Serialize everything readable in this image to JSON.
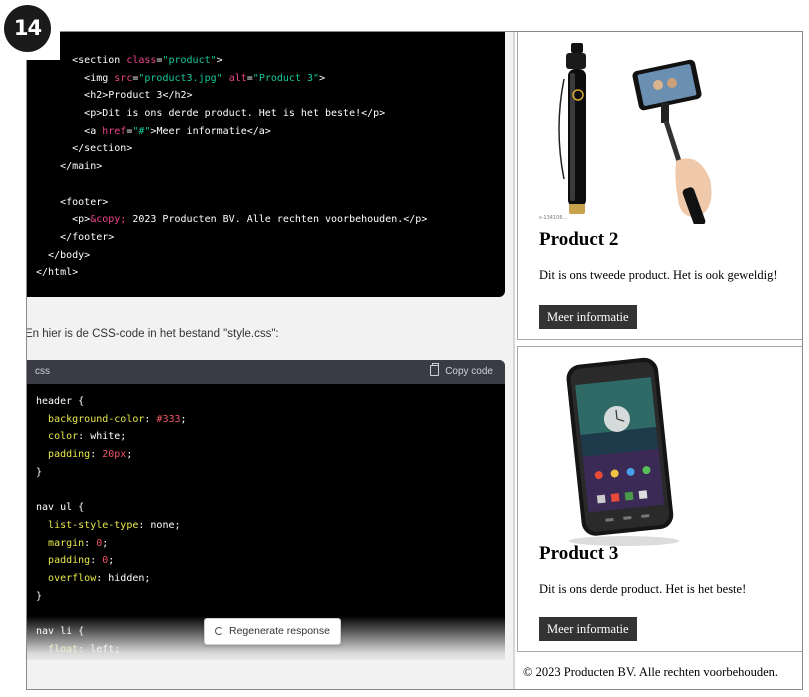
{
  "badge": {
    "number": "14"
  },
  "code_top_lines": [
    {
      "indent": "      ",
      "parts": [
        [
          "tag",
          "<section "
        ],
        [
          "attr",
          "class"
        ],
        [
          "tag",
          "="
        ],
        [
          "str",
          "\"product\""
        ],
        [
          "tag",
          ">"
        ]
      ]
    },
    {
      "indent": "        ",
      "parts": [
        [
          "tag",
          "<img "
        ],
        [
          "attr",
          "src"
        ],
        [
          "tag",
          "="
        ],
        [
          "str",
          "\"product3.jpg\""
        ],
        [
          "tag",
          " "
        ],
        [
          "attr",
          "alt"
        ],
        [
          "tag",
          "="
        ],
        [
          "str",
          "\"Product 3\""
        ],
        [
          "tag",
          ">"
        ]
      ]
    },
    {
      "indent": "        ",
      "parts": [
        [
          "tag",
          "<h2>Product 3</h2>"
        ]
      ]
    },
    {
      "indent": "        ",
      "parts": [
        [
          "tag",
          "<p>Dit is ons derde product. Het is het beste!</p>"
        ]
      ]
    },
    {
      "indent": "        ",
      "parts": [
        [
          "tag",
          "<a "
        ],
        [
          "attr",
          "href"
        ],
        [
          "tag",
          "="
        ],
        [
          "str",
          "\"#\""
        ],
        [
          "tag",
          ">Meer informatie</a>"
        ]
      ]
    },
    {
      "indent": "      ",
      "parts": [
        [
          "tag",
          "</section>"
        ]
      ]
    },
    {
      "indent": "    ",
      "parts": [
        [
          "tag",
          "</main>"
        ]
      ]
    },
    {
      "indent": "",
      "parts": [
        [
          "tag",
          ""
        ]
      ]
    },
    {
      "indent": "    ",
      "parts": [
        [
          "tag",
          "<footer>"
        ]
      ]
    },
    {
      "indent": "      ",
      "parts": [
        [
          "tag",
          "<p>"
        ],
        [
          "attr",
          "&copy;"
        ],
        [
          "tag",
          " 2023 Producten BV. Alle rechten voorbehouden.</p>"
        ]
      ]
    },
    {
      "indent": "    ",
      "parts": [
        [
          "tag",
          "</footer>"
        ]
      ]
    },
    {
      "indent": "  ",
      "parts": [
        [
          "tag",
          "</body>"
        ]
      ]
    },
    {
      "indent": "",
      "parts": [
        [
          "tag",
          "</html>"
        ]
      ]
    }
  ],
  "chat": {
    "intro_text": "En hier is de CSS-code in het bestand \"style.css\":",
    "code_lang": "css",
    "copy_label": "Copy code",
    "regenerate_label": "Regenerate response"
  },
  "css_lines": [
    {
      "indent": "",
      "parts": [
        [
          "tag",
          "header {"
        ]
      ]
    },
    {
      "indent": "  ",
      "parts": [
        [
          "kw",
          "background-color"
        ],
        [
          "tag",
          ": "
        ],
        [
          "num",
          "#333"
        ],
        [
          "tag",
          ";"
        ]
      ]
    },
    {
      "indent": "  ",
      "parts": [
        [
          "kw",
          "color"
        ],
        [
          "tag",
          ": white;"
        ]
      ]
    },
    {
      "indent": "  ",
      "parts": [
        [
          "kw",
          "padding"
        ],
        [
          "tag",
          ": "
        ],
        [
          "num",
          "20px"
        ],
        [
          "tag",
          ";"
        ]
      ]
    },
    {
      "indent": "",
      "parts": [
        [
          "tag",
          "}"
        ]
      ]
    },
    {
      "indent": "",
      "parts": [
        [
          "tag",
          ""
        ]
      ]
    },
    {
      "indent": "",
      "parts": [
        [
          "tag",
          "nav ul {"
        ]
      ]
    },
    {
      "indent": "  ",
      "parts": [
        [
          "kw",
          "list-style-type"
        ],
        [
          "tag",
          ": none;"
        ]
      ]
    },
    {
      "indent": "  ",
      "parts": [
        [
          "kw",
          "margin"
        ],
        [
          "tag",
          ": "
        ],
        [
          "num",
          "0"
        ],
        [
          "tag",
          ";"
        ]
      ]
    },
    {
      "indent": "  ",
      "parts": [
        [
          "kw",
          "padding"
        ],
        [
          "tag",
          ": "
        ],
        [
          "num",
          "0"
        ],
        [
          "tag",
          ";"
        ]
      ]
    },
    {
      "indent": "  ",
      "parts": [
        [
          "kw",
          "overflow"
        ],
        [
          "tag",
          ": hidden;"
        ]
      ]
    },
    {
      "indent": "",
      "parts": [
        [
          "tag",
          "}"
        ]
      ]
    },
    {
      "indent": "",
      "parts": [
        [
          "tag",
          ""
        ]
      ]
    },
    {
      "indent": "",
      "parts": [
        [
          "tag",
          "nav li {"
        ]
      ]
    },
    {
      "indent": "  ",
      "parts": [
        [
          "kw",
          "float"
        ],
        [
          "tag",
          ": left;"
        ]
      ]
    }
  ],
  "preview": {
    "product2": {
      "image_caption": "s-134106...",
      "title": "Product 2",
      "text": "Dit is ons tweede product. Het is ook geweldig!",
      "button": "Meer informatie"
    },
    "product3": {
      "title": "Product 3",
      "text": "Dit is ons derde product. Het is het beste!",
      "button": "Meer informatie"
    },
    "footer": "© 2023 Producten BV. Alle rechten voorbehouden."
  },
  "colors": {
    "code_bg": "#000000",
    "attr": "#ee4488",
    "string": "#18c99a",
    "property": "#e9e94d",
    "number": "#ee5566",
    "button_bg": "#333333"
  }
}
